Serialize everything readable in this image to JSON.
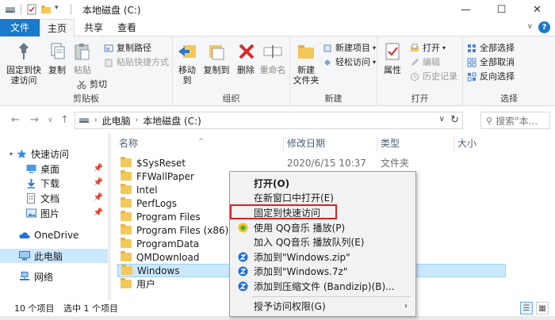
{
  "window": {
    "title": "本地磁盘 (C:)",
    "minimize": "—",
    "maximize": "☐",
    "close": "✕"
  },
  "tabs": [
    "文件",
    "主页",
    "共享",
    "查看"
  ],
  "ribbon": {
    "clipboard": {
      "label": "剪贴板",
      "pin_quick": "固定到快\n速访问",
      "copy": "复制",
      "paste": "粘贴",
      "cut": "剪切",
      "copy_path": "复制路径",
      "paste_shortcut": "粘贴快捷方式"
    },
    "organize": {
      "label": "组织",
      "move_to": "移动到",
      "copy_to": "复制到",
      "delete": "删除",
      "rename": "重命名"
    },
    "new": {
      "label": "新建",
      "new_item": "新建项目",
      "easy_access": "轻松访问",
      "new_folder": "新建\n文件夹"
    },
    "open": {
      "label": "打开",
      "properties": "属性",
      "open": "打开",
      "edit": "编辑",
      "history": "历史记录"
    },
    "select": {
      "label": "选择",
      "select_all": "全部选择",
      "select_none": "全部取消",
      "invert": "反向选择"
    }
  },
  "address": {
    "crumbs": [
      "此电脑",
      "本地磁盘 (C:)"
    ],
    "search_placeholder": "搜索\"本..."
  },
  "nav_pane": {
    "items": [
      {
        "label": "快速访问"
      },
      {
        "label": "桌面"
      },
      {
        "label": "下载"
      },
      {
        "label": "文档"
      },
      {
        "label": "图片"
      },
      {
        "label": "OneDrive"
      },
      {
        "label": "此电脑"
      },
      {
        "label": "网络"
      }
    ]
  },
  "columns": [
    "名称",
    "修改日期",
    "类型",
    "大小"
  ],
  "files": [
    {
      "name": "$SysReset",
      "date": "2020/6/15 10:37",
      "type": "文件夹"
    },
    {
      "name": "FFWallPaper",
      "date": "",
      "type": ""
    },
    {
      "name": "Intel",
      "date": "",
      "type": ""
    },
    {
      "name": "PerfLogs",
      "date": "",
      "type": ""
    },
    {
      "name": "Program Files",
      "date": "",
      "type": ""
    },
    {
      "name": "Program Files (x86)",
      "date": "",
      "type": ""
    },
    {
      "name": "ProgramData",
      "date": "",
      "type": ""
    },
    {
      "name": "QMDownload",
      "date": "",
      "type": ""
    },
    {
      "name": "Windows",
      "date": "",
      "type": ""
    },
    {
      "name": "用户",
      "date": "",
      "type": ""
    }
  ],
  "status": {
    "count": "10 个项目",
    "selected": "选中 1 个项目"
  },
  "context_menu": {
    "items": [
      "打开(O)",
      "在新窗口中打开(E)",
      "固定到快速访问",
      "使用 QQ音乐 播放(P)",
      "加入 QQ音乐 播放队列(E)",
      "添加到\"Windows.zip\"",
      "添加到\"Windows.7z\"",
      "添加到压缩文件 (Bandizip)(B)...",
      "授予访问权限(G)"
    ]
  },
  "colors": {
    "accent": "#1979ca",
    "selection": "#cce8ff",
    "highlight": "#e02020",
    "folder": "#f3c85a"
  }
}
